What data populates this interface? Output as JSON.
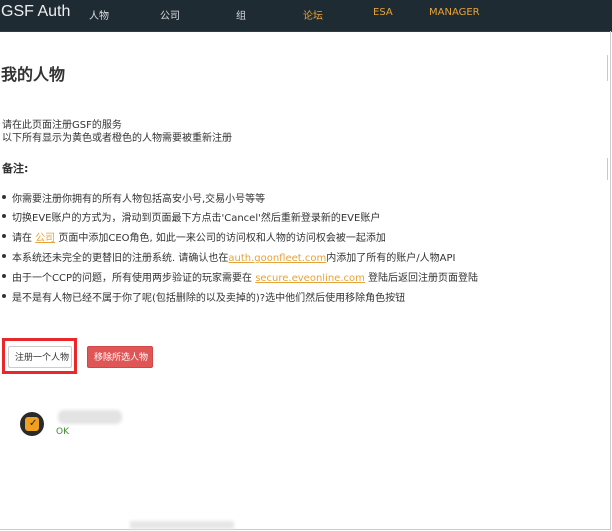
{
  "navbar": {
    "brand": "GSF Auth",
    "items": [
      {
        "label": "人物",
        "active": false
      },
      {
        "label": "公司",
        "active": false
      },
      {
        "label": "组",
        "active": false
      },
      {
        "label": "论坛",
        "active": true
      },
      {
        "label": "ESA",
        "active": true
      },
      {
        "label": "MANAGER",
        "active": true
      }
    ]
  },
  "page": {
    "title": "我的人物",
    "intro_1": "请在此页面注册GSF的服务",
    "intro_2": "以下所有显示为黄色或者橙色的人物需要被重新注册",
    "notes_title": "备注:",
    "notes": [
      {
        "pre": "你需要注册你拥有的所有人物包括高安小号,交易小号等等",
        "link": "",
        "post": ""
      },
      {
        "pre": "切换EVE账户的方式为，滑动到页面最下方点击'Cancel'然后重新登录新的EVE账户",
        "link": "",
        "post": ""
      },
      {
        "pre": "请在 ",
        "link": "公司",
        "post": " 页面中添加CEO角色, 如此一来公司的访问权和人物的访问权会被一起添加"
      },
      {
        "pre": "本系统还未完全的更替旧的注册系统. 请确认也在",
        "link": "auth.goonfleet.com",
        "post": "内添加了所有的账户/人物API"
      },
      {
        "pre": "由于一个CCP的问题，所有使用两步验证的玩家需要在 ",
        "link": "secure.eveonline.com",
        "post": " 登陆后返回注册页面登陆"
      },
      {
        "pre": "是不是有人物已经不属于你了呢(包括删除的以及卖掉的)?选中他们然后使用移除角色按钮",
        "link": "",
        "post": ""
      }
    ],
    "buttons": {
      "register": "注册一个人物",
      "remove": "移除所选人物"
    },
    "character": {
      "status": "OK",
      "status_color": "#3a8f2b"
    }
  },
  "colors": {
    "navbar_bg": "#1f2b33",
    "accent_link": "#e6a33b",
    "remove_button": "#e05555",
    "highlight_box": "#e8282b"
  }
}
